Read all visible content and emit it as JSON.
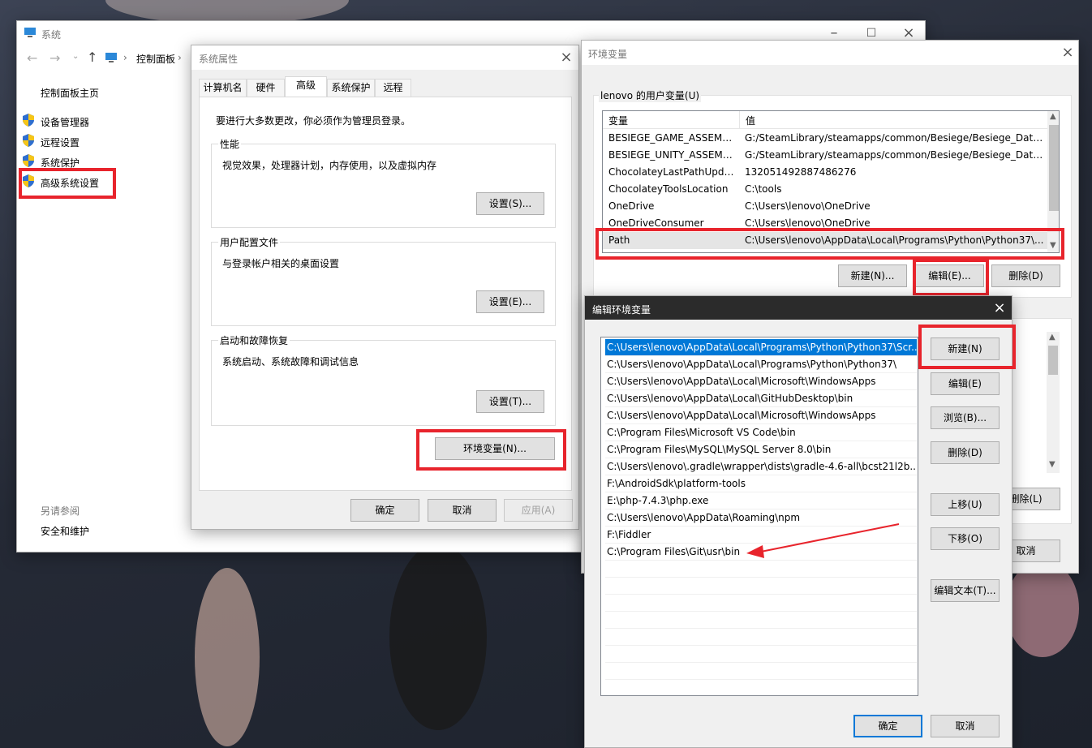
{
  "system_window": {
    "title": "系统",
    "breadcrumb": "控制面板",
    "home_link": "控制面板主页",
    "links": [
      "设备管理器",
      "远程设置",
      "系统保护",
      "高级系统设置"
    ],
    "see_also_title": "另请参阅",
    "see_also_link": "安全和维护"
  },
  "sysprops": {
    "title": "系统属性",
    "tabs": [
      "计算机名",
      "硬件",
      "高级",
      "系统保护",
      "远程"
    ],
    "admin_note": "要进行大多数更改，你必须作为管理员登录。",
    "perf_title": "性能",
    "perf_desc": "视觉效果，处理器计划，内存使用，以及虚拟内存",
    "perf_btn": "设置(S)...",
    "profile_title": "用户配置文件",
    "profile_desc": "与登录帐户相关的桌面设置",
    "profile_btn": "设置(E)...",
    "startup_title": "启动和故障恢复",
    "startup_desc": "系统启动、系统故障和调试信息",
    "startup_btn": "设置(T)...",
    "env_btn": "环境变量(N)...",
    "ok": "确定",
    "cancel": "取消",
    "apply": "应用(A)"
  },
  "envvars": {
    "title": "环境变量",
    "user_group": "lenovo 的用户变量(U)",
    "col_var": "变量",
    "col_val": "值",
    "rows": [
      {
        "var": "BESIEGE_GAME_ASSEMBL...",
        "val": "G:/SteamLibrary/steamapps/common/Besiege/Besiege_Data\\..."
      },
      {
        "var": "BESIEGE_UNITY_ASSEMBL...",
        "val": "G:/SteamLibrary/steamapps/common/Besiege/Besiege_Data\\..."
      },
      {
        "var": "ChocolateyLastPathUpdate",
        "val": "132051492887486276"
      },
      {
        "var": "ChocolateyToolsLocation",
        "val": "C:\\tools"
      },
      {
        "var": "OneDrive",
        "val": "C:\\Users\\lenovo\\OneDrive"
      },
      {
        "var": "OneDriveConsumer",
        "val": "C:\\Users\\lenovo\\OneDrive"
      },
      {
        "var": "Path",
        "val": "C:\\Users\\lenovo\\AppData\\Local\\Programs\\Python\\Python37\\..."
      }
    ],
    "new_btn": "新建(N)...",
    "edit_btn": "编辑(E)...",
    "delete_btn": "删除(D)",
    "sys_delete_btn": "删除(L)",
    "cancel_btn": "取消"
  },
  "editenv": {
    "title": "编辑环境变量",
    "paths": [
      "C:\\Users\\lenovo\\AppData\\Local\\Programs\\Python\\Python37\\Scr...",
      "C:\\Users\\lenovo\\AppData\\Local\\Programs\\Python\\Python37\\",
      "C:\\Users\\lenovo\\AppData\\Local\\Microsoft\\WindowsApps",
      "C:\\Users\\lenovo\\AppData\\Local\\GitHubDesktop\\bin",
      "C:\\Users\\lenovo\\AppData\\Local\\Microsoft\\WindowsApps",
      "C:\\Program Files\\Microsoft VS Code\\bin",
      "C:\\Program Files\\MySQL\\MySQL Server 8.0\\bin",
      "C:\\Users\\lenovo\\.gradle\\wrapper\\dists\\gradle-4.6-all\\bcst21l2b...",
      "F:\\AndroidSdk\\platform-tools",
      "E:\\php-7.4.3\\php.exe",
      "C:\\Users\\lenovo\\AppData\\Roaming\\npm",
      "F:\\Fiddler",
      "C:\\Program Files\\Git\\usr\\bin"
    ],
    "btn_new": "新建(N)",
    "btn_edit": "编辑(E)",
    "btn_browse": "浏览(B)...",
    "btn_delete": "删除(D)",
    "btn_up": "上移(U)",
    "btn_down": "下移(O)",
    "btn_edit_text": "编辑文本(T)...",
    "ok": "确定",
    "cancel": "取消"
  },
  "colors": {
    "highlight": "#e8242c",
    "selection": "#0078d7",
    "arrow": "#e8242c"
  },
  "icons": [
    "shield-icon",
    "close-icon",
    "back-icon",
    "forward-icon",
    "up-icon",
    "computer-icon",
    "maximize-icon",
    "minimize-icon"
  ]
}
